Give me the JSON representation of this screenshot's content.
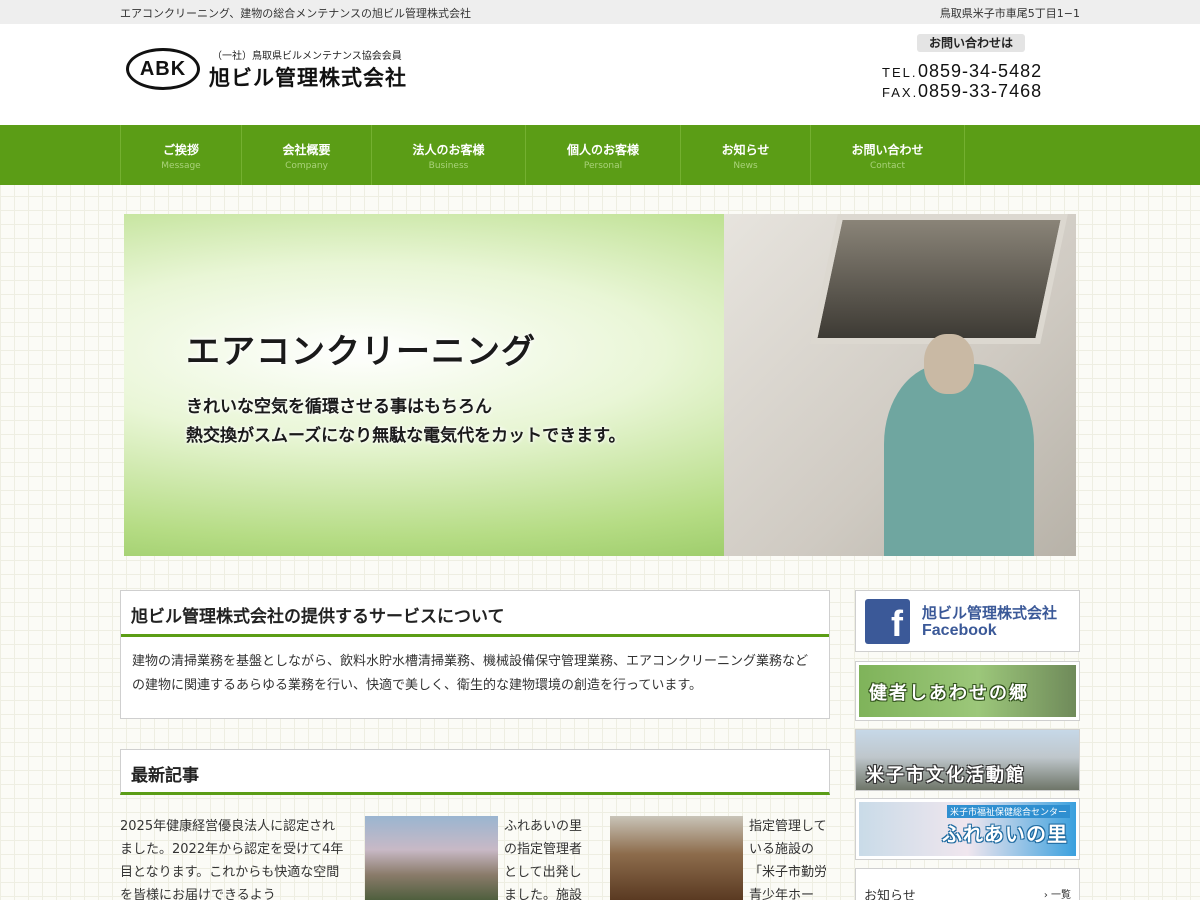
{
  "topbar": {
    "tagline": "エアコンクリーニング、建物の総合メンテナンスの旭ビル管理株式会社",
    "address": "鳥取県米子市車尾5丁目1−1"
  },
  "header": {
    "logo_mark": "ABK",
    "association": "（一社）鳥取県ビルメンテナンス協会会員",
    "company": "旭ビル管理株式会社",
    "contact_label": "お問い合わせは",
    "tel_label": "TEL.",
    "tel": "0859-34-5482",
    "fax_label": "FAX.",
    "fax": "0859-33-7468"
  },
  "nav": {
    "items": [
      {
        "jp": "ご挨拶",
        "en": "Message"
      },
      {
        "jp": "会社概要",
        "en": "Company"
      },
      {
        "jp": "法人のお客様",
        "en": "Business"
      },
      {
        "jp": "個人のお客様",
        "en": "Personal"
      },
      {
        "jp": "お知らせ",
        "en": "News"
      },
      {
        "jp": "お問い合わせ",
        "en": "Contact"
      }
    ]
  },
  "hero": {
    "title": "エアコンクリーニング",
    "line1": "きれいな空気を循環させる事はもちろん",
    "line2": "熱交換がスムーズになり無駄な電気代をカットできます。"
  },
  "services": {
    "title": "旭ビル管理株式会社の提供するサービスについて",
    "body": "建物の清掃業務を基盤としながら、飲料水貯水槽清掃業務、機械設備保守管理業務、エアコンクリーニング業務などの建物に関連するあらゆる業務を行い、快適で美しく、衛生的な建物環境の創造を行っています。"
  },
  "news": {
    "title": "最新記事",
    "articles": [
      {
        "text": "2025年健康経営優良法人に認定されました。2022年から認定を受けて4年目となります。これからも快適な空間を皆様にお届けできるよう"
      },
      {
        "text": "ふれあいの里の指定管理者として出発しました。施設"
      },
      {
        "text": "指定管理している施設の「米子市勤労青少年ホー"
      }
    ]
  },
  "sidebar": {
    "facebook_line1": "旭ビル管理株式会社",
    "facebook_line2": "Facebook",
    "banner2": "健者しあわせの郷",
    "banner3": "米子市文化活動館",
    "banner4_small": "米子市福祉保健総合センター",
    "banner4_main": "ふれあいの里",
    "news_label": "お知らせ",
    "news_more": "一覧"
  }
}
